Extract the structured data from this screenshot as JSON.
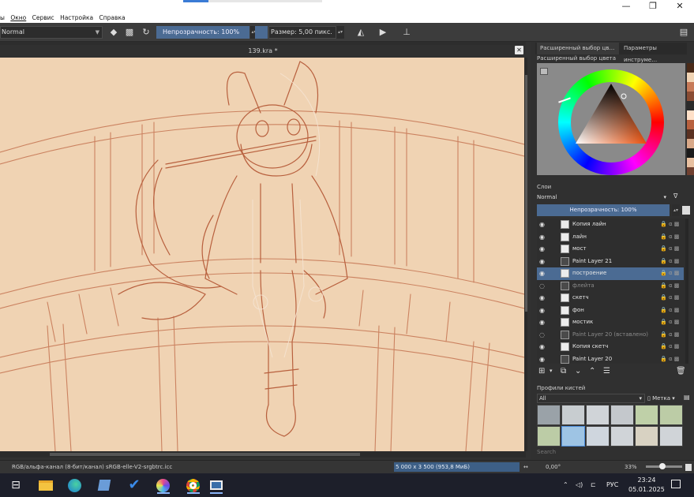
{
  "titlebar": {
    "min_label": "—",
    "max_label": "❐",
    "close_label": "✕"
  },
  "menu": [
    {
      "label": "ы"
    },
    {
      "label": "Окно"
    },
    {
      "label": "Сервис"
    },
    {
      "label": "Настройка"
    },
    {
      "label": "Справка"
    }
  ],
  "toolbar": {
    "blend_mode": "Normal",
    "opacity_label": "Непрозрачность: 100%",
    "size_label": "Размер: 5,00 пикс."
  },
  "document": {
    "tab_title": "139.kra *"
  },
  "right_panel": {
    "tabs": [
      "Расширенный выбор цв…",
      "Параметры инструме…"
    ],
    "color_title": "Расширенный выбор цвета",
    "layers_title": "Слои",
    "layers_blend": "Normal",
    "layers_opacity": "Непрозрачность:  100%",
    "layers": [
      {
        "name": "Копия  лайн",
        "visible": true,
        "dim": false,
        "selected": false,
        "dark": false
      },
      {
        "name": "лайн",
        "visible": true,
        "dim": false,
        "selected": false,
        "dark": false
      },
      {
        "name": "мост",
        "visible": true,
        "dim": false,
        "selected": false,
        "dark": false
      },
      {
        "name": "Paint Layer 21",
        "visible": true,
        "dim": false,
        "selected": false,
        "dark": true
      },
      {
        "name": "построение",
        "visible": true,
        "dim": false,
        "selected": true,
        "dark": false
      },
      {
        "name": "флейта",
        "visible": false,
        "dim": true,
        "selected": false,
        "dark": true
      },
      {
        "name": "скетч",
        "visible": true,
        "dim": false,
        "selected": false,
        "dark": false
      },
      {
        "name": "фон",
        "visible": true,
        "dim": false,
        "selected": false,
        "dark": false
      },
      {
        "name": "мостик",
        "visible": true,
        "dim": false,
        "selected": false,
        "dark": false
      },
      {
        "name": "Paint Layer 20 (вставлено)",
        "visible": false,
        "dim": true,
        "selected": false,
        "dark": true
      },
      {
        "name": "Копия  скетч",
        "visible": true,
        "dim": false,
        "selected": false,
        "dark": false
      },
      {
        "name": "Paint Layer 20",
        "visible": true,
        "dim": false,
        "selected": false,
        "dark": true
      }
    ],
    "brushes_title": "Профили кистей",
    "brushes_filter": "All",
    "brushes_tag": "Метка",
    "brushes_search": "Search"
  },
  "status": {
    "color_info": "RGB/альфа-канал (8-бит/канал)  sRGB-elle-V2-srgbtrc.icc",
    "dims": "5 000 x 3 500 (953,8 МиБ)",
    "rotation": "0,00°",
    "zoom": "33%"
  },
  "tray": {
    "lang": "РУС",
    "time": "23:24",
    "date": "05.01.2025"
  }
}
